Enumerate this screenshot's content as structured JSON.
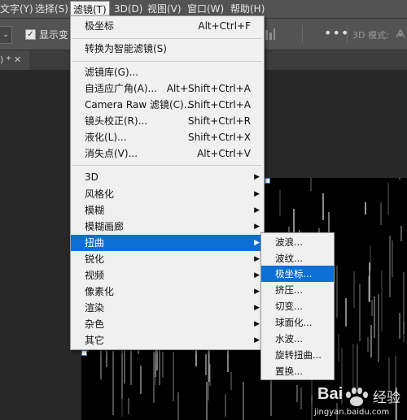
{
  "menubar": {
    "items": [
      {
        "label": "文字(Y)"
      },
      {
        "label": "选择(S)"
      },
      {
        "label": "滤镜(T)"
      },
      {
        "label": "3D(D)"
      },
      {
        "label": "视图(V)"
      },
      {
        "label": "窗口(W)"
      },
      {
        "label": "帮助(H)"
      }
    ]
  },
  "options": {
    "show_transform_label": "显示变",
    "mode_label": "3D 模式:",
    "show_transform_checked": true
  },
  "document": {
    "tab_label": ") *"
  },
  "filter_menu": {
    "items": [
      {
        "label": "极坐标",
        "shortcut": "Alt+Ctrl+F"
      },
      {
        "label": "转换为智能滤镜(S)",
        "shortcut": ""
      },
      {
        "label": "滤镜库(G)...",
        "shortcut": ""
      },
      {
        "label": "自适应广角(A)...",
        "shortcut": "Alt+Shift+Ctrl+A"
      },
      {
        "label": "Camera Raw 滤镜(C)...",
        "shortcut": "Shift+Ctrl+A"
      },
      {
        "label": "镜头校正(R)...",
        "shortcut": "Shift+Ctrl+R"
      },
      {
        "label": "液化(L)...",
        "shortcut": "Shift+Ctrl+X"
      },
      {
        "label": "消失点(V)...",
        "shortcut": "Alt+Ctrl+V"
      },
      {
        "label": "3D",
        "submenu": true
      },
      {
        "label": "风格化",
        "submenu": true
      },
      {
        "label": "模糊",
        "submenu": true
      },
      {
        "label": "模糊画廊",
        "submenu": true
      },
      {
        "label": "扭曲",
        "submenu": true,
        "highlighted": true
      },
      {
        "label": "锐化",
        "submenu": true
      },
      {
        "label": "视频",
        "submenu": true
      },
      {
        "label": "像素化",
        "submenu": true
      },
      {
        "label": "渲染",
        "submenu": true
      },
      {
        "label": "杂色",
        "submenu": true
      },
      {
        "label": "其它",
        "submenu": true
      }
    ]
  },
  "distort_submenu": {
    "items": [
      {
        "label": "波浪..."
      },
      {
        "label": "波纹..."
      },
      {
        "label": "极坐标...",
        "highlighted": true
      },
      {
        "label": "挤压..."
      },
      {
        "label": "切变..."
      },
      {
        "label": "球面化..."
      },
      {
        "label": "水波..."
      },
      {
        "label": "旋转扭曲..."
      },
      {
        "label": "置换..."
      }
    ]
  },
  "watermark": {
    "brand": "Bai",
    "brand_cn": "经验",
    "url": "jingyan.baidu.com"
  },
  "colors": {
    "menu_bg": "#f0f0f0",
    "highlight": "#0b6fd6",
    "chrome": "#535353",
    "canvas": "#000000"
  }
}
